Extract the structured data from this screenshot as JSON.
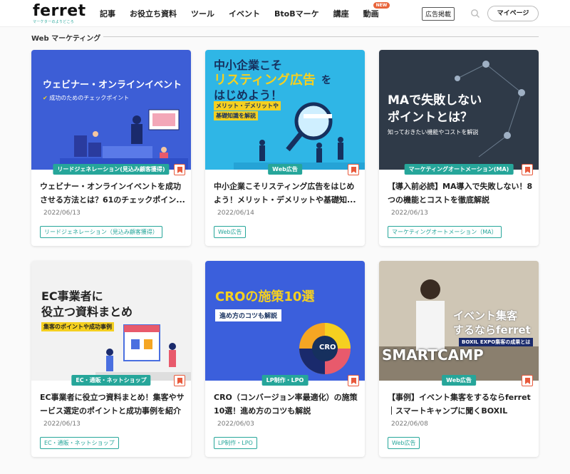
{
  "header": {
    "logo": "ferret",
    "logo_tagline": "マーケターのよりどころ",
    "nav": [
      "記事",
      "お役立ち資料",
      "ツール",
      "イベント",
      "BtoBマーケ",
      "講座",
      "動画"
    ],
    "new_badge": "NEW",
    "ad_button": "広告掲載",
    "mypage_button": "マイページ"
  },
  "section": {
    "title": "Web マーケティング"
  },
  "cards": [
    {
      "thumb_lines": [
        "ウェビナー・オンラインイベント",
        "成功のためのチェックポイント"
      ],
      "category": "リードジェネレーション(見込み顧客獲得)",
      "title": "ウェビナー・オンラインイベントを成功させる方法とは？61のチェックポイン...",
      "date": "2022/06/13",
      "tag": "リードジェネレーション（見込み顧客獲得）"
    },
    {
      "thumb_lines": [
        "中小企業こそ",
        "リスティング広告",
        "を",
        "はじめよう！",
        "メリット・デメリットや",
        "基礎知識を解説"
      ],
      "category": "Web広告",
      "title": "中小企業こそリスティング広告をはじめよう！メリット・デメリットや基礎知...",
      "date": "2022/06/14",
      "tag": "Web広告"
    },
    {
      "thumb_lines": [
        "MAで失敗しない",
        "ポイントとは？",
        "知っておきたい機能やコストを解説"
      ],
      "category": "マーケティングオートメーション(MA)",
      "title": "【導入前必読】MA導入で失敗しない！8つの機能とコストを徹底解説",
      "date": "2022/06/13",
      "tag": "マーケティングオートメーション（MA）"
    },
    {
      "thumb_lines": [
        "EC事業者に",
        "役立つ資料まとめ",
        "集客のポイントや成功事例"
      ],
      "category": "EC・通販・ネットショップ",
      "title": "EC事業者に役立つ資料まとめ！集客やサービス選定のポイントと成功事例を紹介",
      "date": "2022/06/13",
      "tag": "EC・通販・ネットショップ"
    },
    {
      "thumb_lines": [
        "CROの施策10選",
        "進め方のコツも解説",
        "CRO"
      ],
      "category": "LP制作・LPO",
      "title": "CRO（コンバージョン率最適化）の施策10選！進め方のコツも解説",
      "date": "2022/06/03",
      "tag": "LP制作・LPO"
    },
    {
      "thumb_lines": [
        "イベント集客",
        "するならferret",
        "BOXIL EXPO集客の成果とは",
        "SMARTCAMP"
      ],
      "category": "Web広告",
      "title": "【事例】イベント集客をするならferret｜スマートキャンプに聞くBOXIL EXP...",
      "date": "2022/06/08",
      "tag": "Web広告"
    }
  ]
}
